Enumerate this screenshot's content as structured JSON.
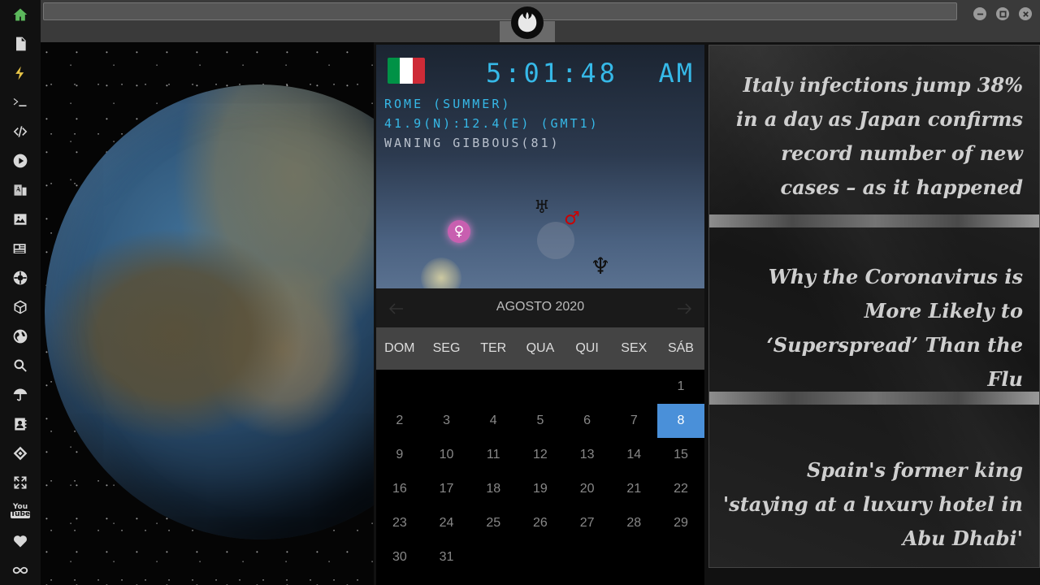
{
  "sidebar": {
    "items": [
      {
        "icon": "home-icon"
      },
      {
        "icon": "document-icon"
      },
      {
        "icon": "lightning-icon"
      },
      {
        "icon": "terminal-icon"
      },
      {
        "icon": "code-icon"
      },
      {
        "icon": "play-icon"
      },
      {
        "icon": "translate-icon"
      },
      {
        "icon": "image-icon"
      },
      {
        "icon": "newspaper-icon"
      },
      {
        "icon": "settings-cog-icon"
      },
      {
        "icon": "cube-icon"
      },
      {
        "icon": "globe-icon"
      },
      {
        "icon": "search-icon"
      },
      {
        "icon": "umbrella-icon"
      },
      {
        "icon": "contacts-icon"
      },
      {
        "icon": "link-icon"
      },
      {
        "icon": "expand-icon"
      },
      {
        "icon": "youtube-icon",
        "label_top": "You",
        "label_bottom": "Tube"
      },
      {
        "icon": "heart-icon"
      },
      {
        "icon": "infinity-icon"
      }
    ],
    "active_color": "#5cb85c",
    "icon_color": "#d8d8d8"
  },
  "clock": {
    "time": "5:01:48",
    "ampm": "AM",
    "city": "ROME (SUMMER)",
    "coordinates": "41.9(N):12.4(E) (GMT1)",
    "moon": "WANING GIBBOUS(81)",
    "flag_colors": [
      "#009246",
      "#ffffff",
      "#ce2b37"
    ]
  },
  "planets": {
    "venus": "♀",
    "uranus": "♅",
    "mars": "♂",
    "neptune": "♆"
  },
  "calendar": {
    "title": "AGOSTO 2020",
    "weekdays": [
      "DOM",
      "SEG",
      "TER",
      "QUA",
      "QUI",
      "SEX",
      "SÁB"
    ],
    "selected_day": "8",
    "accent": "#4a90d9"
  },
  "news": {
    "headlines": [
      "Italy infections jump 38% in a day as Japan confirms record number of new cases – as it happened",
      "Why the Coronavirus is More Likely to ‘Superspread’ Than the Flu",
      "Spain's former king 'staying at a luxury hotel in Abu Dhabi'"
    ]
  }
}
